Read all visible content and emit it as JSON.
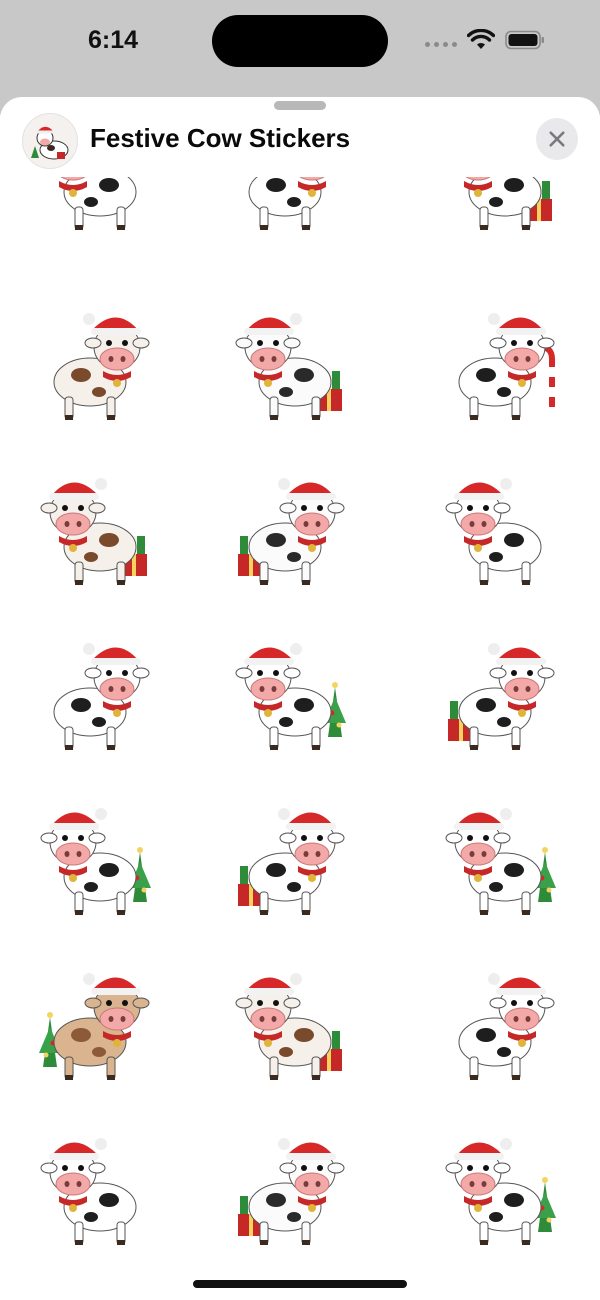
{
  "status_bar": {
    "time": "6:14"
  },
  "sheet": {
    "title": "Festive Cow Stickers"
  },
  "stickers": [
    {
      "name": "sticker-cow-scarf-pompom",
      "variant": "spotted",
      "extra": "none"
    },
    {
      "name": "sticker-cow-red-scarf",
      "variant": "spotted",
      "extra": "none"
    },
    {
      "name": "sticker-cow-gift-stack",
      "variant": "spotted",
      "extra": "gifts"
    },
    {
      "name": "sticker-cow-holly-hat",
      "variant": "brown",
      "extra": "none"
    },
    {
      "name": "sticker-cow-bells-gifts",
      "variant": "white",
      "extra": "gifts"
    },
    {
      "name": "sticker-cow-candy-cane",
      "variant": "spotted",
      "extra": "candy"
    },
    {
      "name": "sticker-cow-wreath",
      "variant": "brown",
      "extra": "gifts"
    },
    {
      "name": "sticker-cow-carrying-gift",
      "variant": "white",
      "extra": "gifts"
    },
    {
      "name": "sticker-cow-ornament",
      "variant": "spotted",
      "extra": "none"
    },
    {
      "name": "sticker-cow-dancing",
      "variant": "spotted",
      "extra": "none"
    },
    {
      "name": "sticker-cow-tree",
      "variant": "spotted",
      "extra": "tree"
    },
    {
      "name": "sticker-cow-sunglasses",
      "variant": "spotted",
      "extra": "gifts"
    },
    {
      "name": "sticker-cow-sleigh-tree",
      "variant": "spotted",
      "extra": "tree"
    },
    {
      "name": "sticker-cow-present-pile",
      "variant": "spotted",
      "extra": "gifts"
    },
    {
      "name": "sticker-cow-sweater-tree",
      "variant": "spotted",
      "extra": "tree"
    },
    {
      "name": "sticker-cow-sitting-bow",
      "variant": "tan",
      "extra": "tree"
    },
    {
      "name": "sticker-cow-goggles-gift",
      "variant": "brown",
      "extra": "gifts"
    },
    {
      "name": "sticker-cow-big-scarf",
      "variant": "spotted",
      "extra": "none"
    },
    {
      "name": "sticker-cow-sleigh",
      "variant": "spotted",
      "extra": "none"
    },
    {
      "name": "sticker-cow-santa-sack",
      "variant": "white",
      "extra": "gifts"
    },
    {
      "name": "sticker-cow-snowy-trees",
      "variant": "spotted",
      "extra": "tree"
    }
  ]
}
